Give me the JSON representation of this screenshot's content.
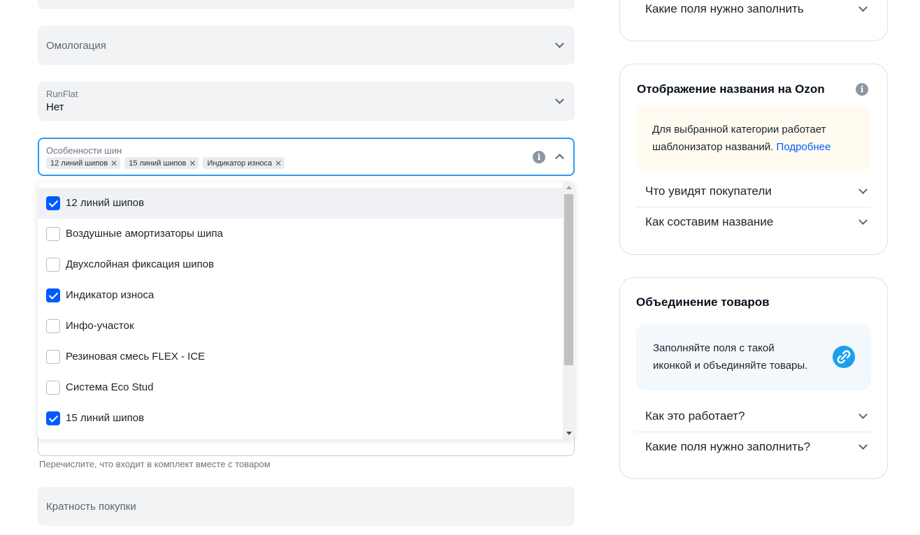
{
  "form": {
    "homologation": {
      "label": "Омологация"
    },
    "runflat": {
      "label": "RunFlat",
      "value": "Нет"
    },
    "tire_features": {
      "label": "Особенности шин",
      "chips": [
        "12 линий шипов",
        "15 линий шипов",
        "Индикатор износа"
      ]
    },
    "dropdown": {
      "options": [
        {
          "label": "12 линий шипов",
          "checked": true
        },
        {
          "label": "Воздушные амортизаторы шипа",
          "checked": false
        },
        {
          "label": "Двухслойная фиксация шипов",
          "checked": false
        },
        {
          "label": "Индикатор износа",
          "checked": true
        },
        {
          "label": "Инфо-участок",
          "checked": false
        },
        {
          "label": "Резиновая смесь FLEX - ICE",
          "checked": false
        },
        {
          "label": "Система Eco Stud",
          "checked": false
        },
        {
          "label": "15 линий шипов",
          "checked": true
        }
      ]
    },
    "komplekt_hint": "Перечислите, что входит в комплект вместе с товаром",
    "purchase_multiple": {
      "label": "Кратность покупки"
    }
  },
  "right": {
    "top_card": {
      "row_label": "Какие поля нужно заполнить"
    },
    "name_card": {
      "title": "Отображение названия на Ozon",
      "note_text": "Для выбранной категории работает шаблонизатор названий.",
      "note_link": "Подробнее",
      "rows": [
        "Что увидят покупатели",
        "Как составим название"
      ]
    },
    "merge_card": {
      "title": "Объединение товаров",
      "note_line1": "Заполняйте поля с такой",
      "note_line2": "иконкой и объединяйте товары.",
      "rows": [
        "Как это работает?",
        "Какие поля нужно заполнить?"
      ]
    }
  },
  "colors": {
    "accent": "#005bff",
    "focus_border": "#2e9bf0",
    "field_bg": "#f2f3f5",
    "note_yellow": "#fffbf0",
    "note_blue": "#f3f8fd",
    "merge_icon": "#1aa1e9"
  },
  "icons": {
    "chevron": "chevron-down-icon",
    "info": "info-icon",
    "remove": "close-icon",
    "merge": "merge-link-icon"
  }
}
